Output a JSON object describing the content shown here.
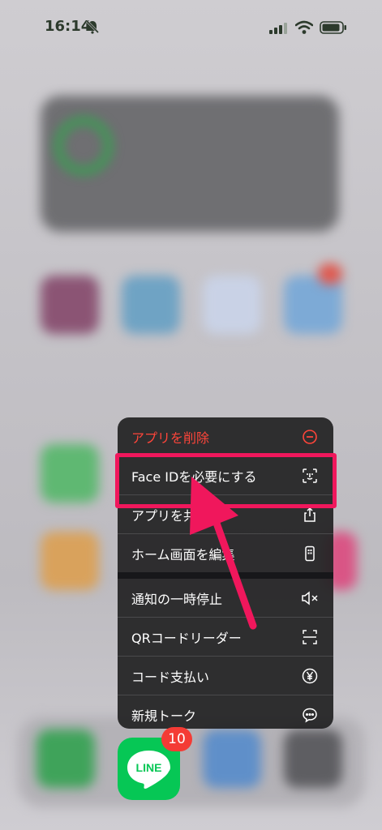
{
  "status_bar": {
    "time": "16:14"
  },
  "context_menu": {
    "items": [
      {
        "label": "アプリを削除",
        "icon": "minus-circle-icon",
        "color": "#ff453a"
      },
      {
        "label": "Face IDを必要にする",
        "icon": "face-id-icon"
      },
      {
        "label": "アプリを共有",
        "icon": "share-icon"
      },
      {
        "label": "ホーム画面を編集",
        "icon": "phone-screen-icon"
      },
      {
        "label": "通知の一時停止",
        "icon": "speaker-mute-icon"
      },
      {
        "label": "QRコードリーダー",
        "icon": "qr-scan-icon"
      },
      {
        "label": "コード支払い",
        "icon": "yen-circle-icon"
      },
      {
        "label": "新規トーク",
        "icon": "chat-bubble-icon"
      }
    ]
  },
  "dock": {
    "line_app": {
      "label": "LINE",
      "badge": "10"
    }
  },
  "highlight_color": "#f0175c"
}
